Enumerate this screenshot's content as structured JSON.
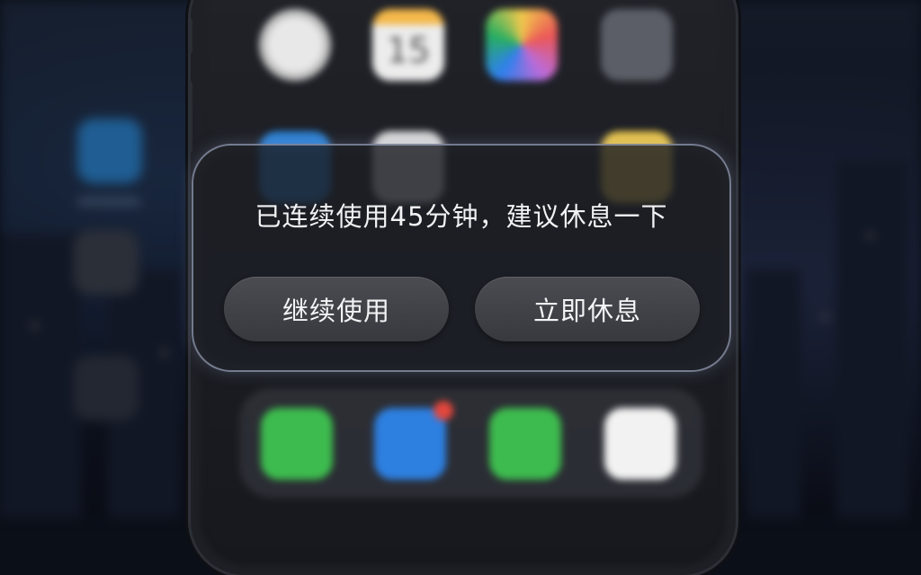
{
  "dialog": {
    "message": "已连续使用45分钟，建议休息一下",
    "continue_label": "继续使用",
    "rest_label": "立即休息"
  },
  "home_screen": {
    "row1": [
      {
        "icon": "clock-icon"
      },
      {
        "icon": "calendar-icon",
        "day": "15"
      },
      {
        "icon": "photos-icon"
      },
      {
        "icon": "camera-icon"
      }
    ],
    "dock": [
      {
        "icon": "phone-icon",
        "color": "#3dbb4e"
      },
      {
        "icon": "appstore-icon",
        "color": "#2d7fe0"
      },
      {
        "icon": "messages-icon",
        "color": "#3dbb4e"
      },
      {
        "icon": "music-icon",
        "color": "#f2f2f2"
      }
    ]
  },
  "colors": {
    "dialog_border": "#bec8e6",
    "button_bg": "#414349",
    "text": "#f2f2f4"
  }
}
